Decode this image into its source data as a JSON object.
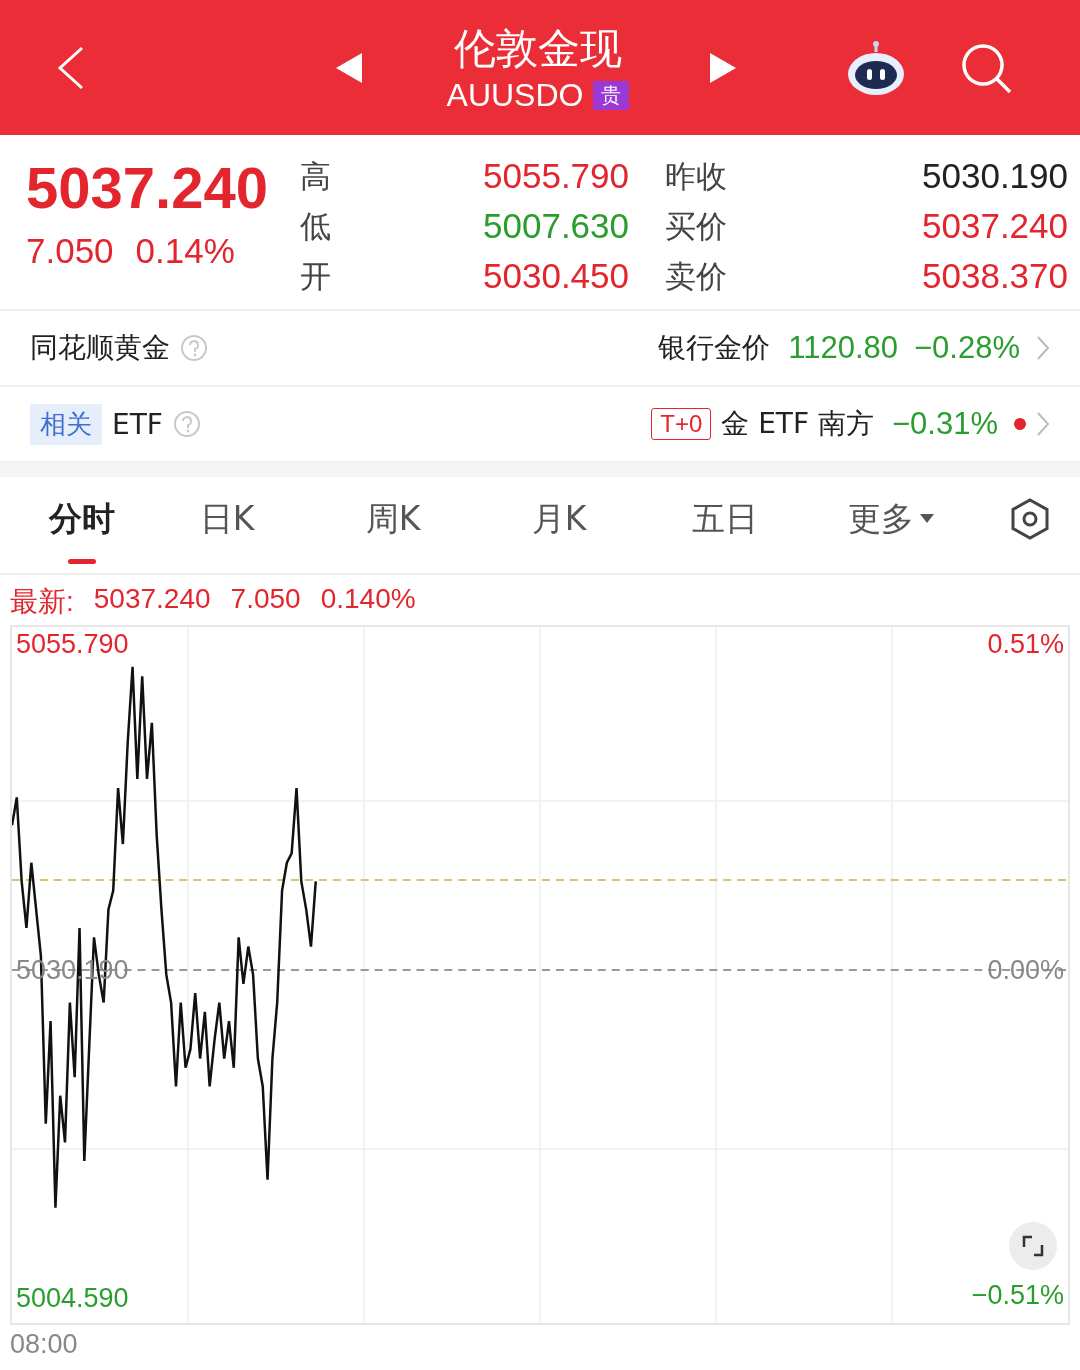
{
  "header": {
    "title": "伦敦金现",
    "symbol": "AUUSDO",
    "badge": "贵"
  },
  "quote": {
    "price": "5037.240",
    "change": "7.050",
    "percent": "0.14%",
    "color": "#e3252d"
  },
  "stats": [
    {
      "label": "高",
      "value": "5055.790",
      "color": "#e3252d"
    },
    {
      "label": "昨收",
      "value": "5030.190",
      "color": "#222222"
    },
    {
      "label": "低",
      "value": "5007.630",
      "color": "#2a9d2f"
    },
    {
      "label": "买价",
      "value": "5037.240",
      "color": "#e3252d"
    },
    {
      "label": "开",
      "value": "5030.450",
      "color": "#e3252d"
    },
    {
      "label": "卖价",
      "value": "5038.370",
      "color": "#e3252d"
    }
  ],
  "bank_row": {
    "name": "同花顺黄金",
    "label": "银行金价",
    "price": "1120.80",
    "change": "−0.28%",
    "color": "#2a9d2f"
  },
  "etf_row": {
    "tag": "相关",
    "name": "ETF",
    "badge": "T+0",
    "fund": "金 ETF 南方",
    "change": "−0.31%",
    "color": "#2a9d2f"
  },
  "tabs": [
    {
      "label": "分时",
      "selected": true
    },
    {
      "label": "日K",
      "selected": false
    },
    {
      "label": "周K",
      "selected": false
    },
    {
      "label": "月K",
      "selected": false
    },
    {
      "label": "五日",
      "selected": false
    },
    {
      "label": "更多",
      "selected": false,
      "kind": "dropdown"
    }
  ],
  "latest": {
    "label": "最新:",
    "price": "5037.240",
    "change": "7.050",
    "percent": "0.140%"
  },
  "chart": {
    "top_pct": "0.51%",
    "mid_pct": "0.00%",
    "bottom_pct": "−0.51%",
    "start_time": "08:00",
    "chart_data": {
      "type": "line",
      "grid": true,
      "ylim": [
        5002.49,
        5057.09
      ],
      "ref_lines": [
        {
          "axis": "y",
          "value": 5030.19,
          "color": "#999999"
        },
        {
          "axis": "y",
          "value": 5037.24,
          "color": "#e0c070"
        }
      ],
      "categories": [
        null,
        null,
        null,
        null,
        null,
        null,
        null,
        null,
        null,
        null,
        null,
        null,
        null,
        null,
        null,
        null,
        null,
        null,
        null,
        null,
        null,
        null,
        null,
        null,
        null,
        null,
        null,
        null,
        null,
        null,
        null,
        null,
        null,
        null,
        null,
        null,
        null,
        null,
        null,
        null,
        null,
        null,
        null,
        null,
        null,
        null,
        null,
        null,
        null,
        null,
        null,
        null,
        null,
        null,
        null,
        null,
        null,
        null,
        null,
        null,
        null,
        null,
        null,
        null,
        null,
        null,
        null,
        null,
        null,
        null,
        null,
        null,
        null,
        null,
        null,
        null,
        null,
        null,
        null,
        null,
        null,
        null,
        null,
        null,
        null,
        null,
        null,
        null,
        null,
        null,
        null,
        null,
        null,
        null,
        null,
        null,
        null,
        null,
        null,
        null,
        null,
        null,
        null,
        null,
        null,
        null,
        null,
        null,
        null,
        null,
        null,
        null,
        null,
        null,
        null,
        null,
        null,
        null,
        null,
        null,
        null,
        null,
        null,
        null,
        null,
        null,
        null,
        null,
        null,
        null,
        null,
        null,
        null,
        null,
        null,
        null,
        null,
        null,
        null,
        null,
        null,
        null,
        null,
        null,
        null,
        null,
        null,
        null,
        null,
        null,
        null,
        null,
        null,
        null,
        null,
        null,
        null,
        null,
        null,
        null,
        null,
        null,
        null,
        null,
        null,
        null,
        null,
        null,
        null,
        null,
        null,
        null,
        null,
        null,
        null,
        null,
        null,
        null,
        null,
        null,
        null,
        null,
        null,
        null,
        null,
        null,
        null,
        null,
        null,
        null,
        null,
        null,
        null,
        null,
        null,
        null,
        null,
        null,
        null,
        null,
        null,
        null,
        null,
        null,
        null,
        null,
        null,
        null,
        null,
        null,
        null,
        null,
        null,
        null,
        null,
        null,
        null,
        null,
        null,
        null
      ],
      "yticks": [
        {
          "value": 5004.59,
          "label": "5004.590"
        },
        {
          "value": 5030.19,
          "label": "5030.190"
        },
        {
          "value": 5055.79,
          "label": "5055.790"
        }
      ],
      "series": [
        {
          "color": "#111111",
          "values": [
            5041.53,
            5043.72,
            5037.14,
            5033.48,
            5038.6,
            5034.94,
            5031.29,
            5018.12,
            5026.17,
            5011.54,
            5020.32,
            5016.66,
            5027.63,
            5021.78,
            5033.48,
            5015.2,
            5023.97,
            5032.75,
            5029.82,
            5027.63,
            5034.94,
            5036.41,
            5044.45,
            5040.06,
            5048.11,
            5053.96,
            5045.18,
            5053.23,
            5045.18,
            5049.57,
            5040.8,
            5034.94,
            5029.82,
            5027.63,
            5021.05,
            5027.63,
            5022.51,
            5023.97,
            5028.36,
            5023.24,
            5026.9,
            5021.05,
            5024.7,
            5027.63,
            5023.24,
            5026.17,
            5022.51,
            5032.75,
            5029.09,
            5032.02,
            5029.82,
            5023.24,
            5021.05,
            5013.73,
            5023.24,
            5027.63,
            5036.41,
            5038.6,
            5039.33,
            5044.45,
            5037.14,
            5034.94,
            5032.02,
            5037.14,
            null,
            null,
            null,
            null,
            null,
            null,
            null,
            null,
            null,
            null,
            null,
            null,
            null,
            null,
            null,
            null,
            null,
            null,
            null,
            null,
            null,
            null,
            null,
            null,
            null,
            null,
            null,
            null,
            null,
            null,
            null,
            null,
            null,
            null,
            null,
            null,
            null,
            null,
            null,
            null,
            null,
            null,
            null,
            null,
            null,
            null,
            null,
            null,
            null,
            null,
            null,
            null,
            null,
            null,
            null,
            null,
            null,
            null,
            null,
            null,
            null,
            null,
            null,
            null,
            null,
            null,
            null,
            null,
            null,
            null,
            null,
            null,
            null,
            null,
            null,
            null,
            null,
            null,
            null,
            null,
            null,
            null,
            null,
            null,
            null,
            null,
            null,
            null,
            null,
            null,
            null,
            null,
            null,
            null,
            null,
            null,
            null,
            null,
            null,
            null,
            null,
            null,
            null,
            null,
            null,
            null,
            null,
            null,
            null,
            null,
            null,
            null,
            null,
            null,
            null,
            null,
            null,
            null,
            null,
            null,
            null,
            null,
            null,
            null,
            null,
            null,
            null,
            null,
            null,
            null,
            null,
            null,
            null,
            null,
            null,
            null,
            null,
            null,
            null,
            null,
            null,
            null,
            null,
            null,
            null,
            null,
            null,
            null,
            null,
            null,
            null,
            null,
            null,
            null,
            null,
            null
          ]
        }
      ]
    }
  }
}
